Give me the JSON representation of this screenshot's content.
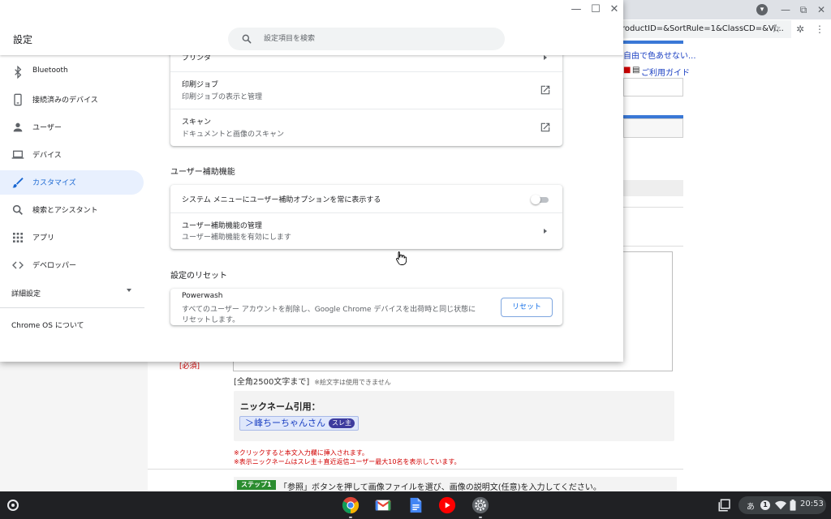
{
  "browser": {
    "omnibox_text": "roductID=&SortRule=1&ClassCD=&Vi...",
    "bg_texts": {
      "top_link": "自由で色あせない...",
      "guide_link": "ご利用ガイド"
    },
    "required_label": "[必須]",
    "char_limit": "[全角2500文字まで]",
    "char_note": "※絵文字は使用できません",
    "nickname_title": "ニックネーム引用：",
    "nickname_chip": "＞峰ちーちゃんさん",
    "nickname_badge": "スレ主",
    "note1": "※クリックすると本文入力欄に挿入されます。",
    "note2": "※表示ニックネームはスレ主＋直近返信ユーザー最大10名を表示しています。",
    "step_badge": "ステップ1",
    "step_text": "「参照」ボタンを押して画像ファイルを選び、画像の説明文(任意)を入力してください。"
  },
  "settings": {
    "title": "設定",
    "search_placeholder": "設定項目を検索",
    "sidebar": {
      "items": [
        {
          "label": "Bluetooth",
          "icon": "bluetooth-icon"
        },
        {
          "label": "接続済みのデバイス",
          "icon": "phone-icon"
        },
        {
          "label": "ユーザー",
          "icon": "person-icon"
        },
        {
          "label": "デバイス",
          "icon": "laptop-icon"
        },
        {
          "label": "カスタマイズ",
          "icon": "brush-icon",
          "active": true
        },
        {
          "label": "検索とアシスタント",
          "icon": "search-icon"
        },
        {
          "label": "アプリ",
          "icon": "apps-grid-icon"
        },
        {
          "label": "デベロッパー",
          "icon": "code-icon"
        }
      ],
      "advanced": "詳細設定",
      "about": "Chrome OS について"
    },
    "printing": {
      "printer_label": "プリンタ",
      "print_jobs_title": "印刷ジョブ",
      "print_jobs_sub": "印刷ジョブの表示と管理",
      "scan_title": "スキャン",
      "scan_sub": "ドキュメントと画像のスキャン"
    },
    "accessibility": {
      "section_title": "ユーザー補助機能",
      "always_show_label": "システム メニューにユーザー補助オプションを常に表示する",
      "manage_title": "ユーザー補助機能の管理",
      "manage_sub": "ユーザー補助機能を有効にします"
    },
    "reset": {
      "section_title": "設定のリセット",
      "powerwash_title": "Powerwash",
      "powerwash_desc_line1": "すべてのユーザー アカウントを削除し、Google Chrome デバイスを出荷時と同じ状態に",
      "powerwash_desc_line2": "リセットします。",
      "reset_button": "リセット"
    }
  },
  "shelf": {
    "ime": "あ",
    "notification_count": "1",
    "time": "20:53"
  },
  "colors": {
    "accent": "#1a73e8",
    "active_nav_bg": "#e8f0fe",
    "shelf_bg": "#202124"
  }
}
